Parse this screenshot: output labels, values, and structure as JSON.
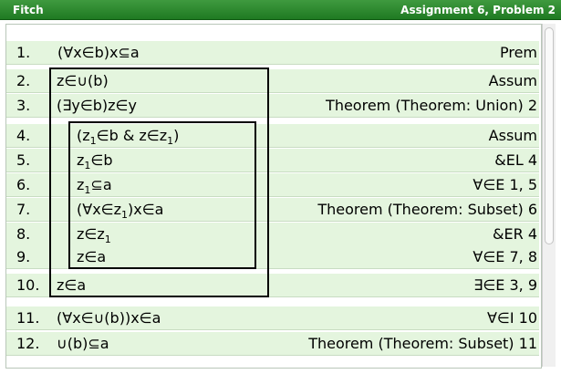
{
  "titlebar": {
    "app": "Fitch",
    "assignment": "Assignment 6, Problem 2"
  },
  "colors": {
    "title_green": "#1f7a22",
    "row_green": "#e4f5de"
  },
  "proof": [
    {
      "num": "1.",
      "formula": "(∀x∈b)x⊆a",
      "just": "Prem"
    },
    {
      "num": "2.",
      "formula": "z∈∪(b)",
      "just": "Assum"
    },
    {
      "num": "3.",
      "formula": "(∃y∈b)z∈y",
      "just": "Theorem (Theorem: Union) 2"
    },
    {
      "num": "4.",
      "formula_parts": [
        "(z",
        "1",
        "∈b & z∈z",
        "1",
        ")"
      ],
      "just": "Assum"
    },
    {
      "num": "5.",
      "formula_parts": [
        "z",
        "1",
        "∈b"
      ],
      "just": "&EL 4"
    },
    {
      "num": "6.",
      "formula_parts": [
        "z",
        "1",
        "⊆a"
      ],
      "just": "∀∈E 1, 5"
    },
    {
      "num": "7.",
      "formula_parts": [
        "(∀x∈z",
        "1",
        ")x∈a"
      ],
      "just": "Theorem (Theorem: Subset) 6"
    },
    {
      "num": "8.",
      "formula_parts": [
        "z∈z",
        "1"
      ],
      "just": "&ER 4"
    },
    {
      "num": "9.",
      "formula": "z∈a",
      "just": "∀∈E 7, 8"
    },
    {
      "num": "10.",
      "formula": "z∈a",
      "just": "∃∈E 3, 9"
    },
    {
      "num": "11.",
      "formula": "(∀x∈∪(b))x∈a",
      "just": "∀∈I 10"
    },
    {
      "num": "12.",
      "formula": "∪(b)⊆a",
      "just": "Theorem (Theorem: Subset) 11"
    }
  ]
}
